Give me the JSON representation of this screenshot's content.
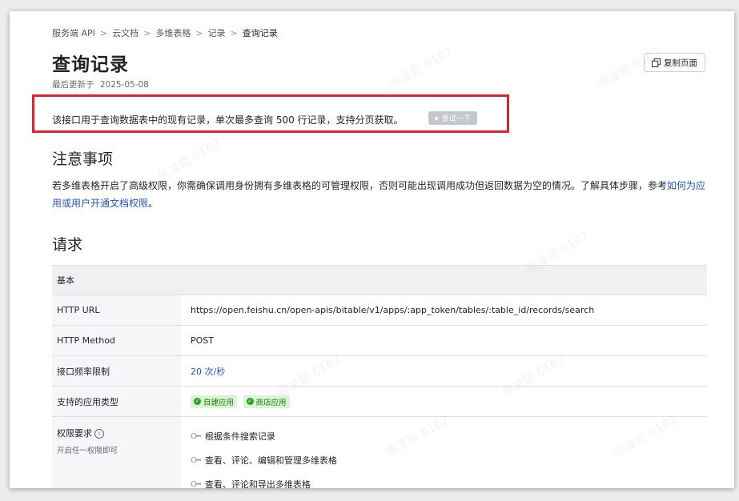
{
  "breadcrumb": {
    "items": [
      "服务端 API",
      "云文档",
      "多维表格",
      "记录"
    ],
    "current": "查询记录",
    "separator": ">"
  },
  "page": {
    "title": "查询记录",
    "updated_label": "最后更新于",
    "updated_date": "2025-05-08",
    "copy_button": "复制页面"
  },
  "intro": {
    "text": "该接口用于查询数据表中的现有记录，单次最多查询 500 行记录，支持分页获取。",
    "try_button": "尝试一下",
    "play_glyph": "▶"
  },
  "notice": {
    "heading": "注意事项",
    "text": "若多维表格开启了高级权限，你需确保调用身份拥有多维表格的可管理权限，否则可能出现调用成功但返回数据为空的情况。了解具体步骤，参考",
    "link": "如何为应用或用户开通文档权限",
    "end": "。"
  },
  "request": {
    "heading": "请求",
    "table_header": "基本",
    "rows": {
      "url": {
        "label": "HTTP URL",
        "value": "https://open.feishu.cn/open-apis/bitable/v1/apps/:app_token/tables/:table_id/records/search"
      },
      "method": {
        "label": "HTTP Method",
        "value": "POST"
      },
      "rate": {
        "label": "接口频率限制",
        "value": "20 次/秒"
      },
      "app_types": {
        "label": "支持的应用类型",
        "tags": [
          "自建应用",
          "商店应用"
        ]
      },
      "permissions": {
        "label": "权限要求",
        "info_glyph": "i",
        "sub": "开启任一权限即可",
        "items": [
          "根据条件搜索记录",
          "查看、评论、编辑和管理多维表格",
          "查看、评论和导出多维表格"
        ]
      }
    }
  },
  "watermark": {
    "text": "蔡凌哲 6162"
  },
  "colors": {
    "highlight_border": "#e0242b",
    "link": "#2455c4",
    "tag_bg": "#d9f5d6"
  }
}
